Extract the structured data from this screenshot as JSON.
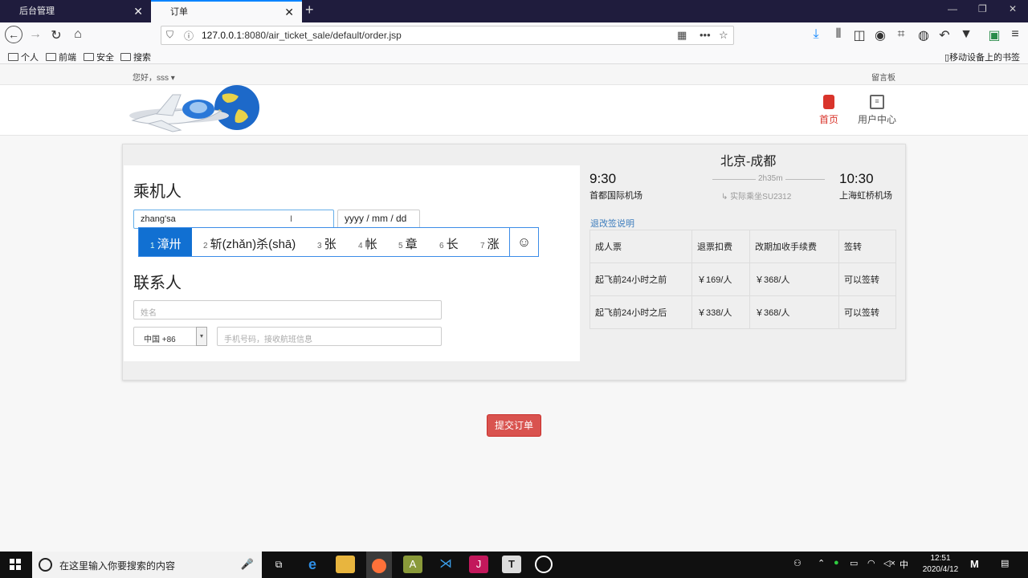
{
  "browser": {
    "tabs": [
      {
        "title": "后台管理"
      },
      {
        "title": "订单"
      }
    ],
    "url_host": "127.0.0.1",
    "url_rest": ":8080/air_ticket_sale/default/order.jsp",
    "bookmarks": [
      "个人",
      "前端",
      "安全",
      "搜索"
    ],
    "mobile_bookmarks": "移动设备上的书签"
  },
  "site": {
    "greeting": "您好，sss",
    "message_board": "留言板",
    "nav": [
      {
        "label": "首页"
      },
      {
        "label": "用户中心"
      }
    ]
  },
  "passenger": {
    "heading": "乘机人",
    "name_value": "zhang'sa",
    "date_placeholder": "yyyy / mm / dd"
  },
  "ime": {
    "candidates": [
      {
        "n": "1",
        "text": "漳卅"
      },
      {
        "n": "2",
        "text": "斩(zhǎn)杀(shā)"
      },
      {
        "n": "3",
        "text": "张"
      },
      {
        "n": "4",
        "text": "帐"
      },
      {
        "n": "5",
        "text": "章"
      },
      {
        "n": "6",
        "text": "长"
      },
      {
        "n": "7",
        "text": "涨"
      }
    ],
    "emoji": "☺"
  },
  "contact": {
    "heading": "联系人",
    "name_placeholder": "姓名",
    "country": "中国  +86",
    "phone_placeholder": "手机号码，接收航班信息"
  },
  "flight": {
    "route": "北京-成都",
    "depart_time": "9:30",
    "depart_airport": "首都国际机场",
    "arrive_time": "10:30",
    "arrive_airport": "上海虹桥机场",
    "duration": "2h35m",
    "flight_no": "实际乘坐SU2312",
    "refund_link": "退改签说明",
    "table": {
      "headers": [
        "成人票",
        "退票扣费",
        "改期加收手续费",
        "签转"
      ],
      "rows": [
        [
          "起飞前24小时之前",
          "￥169/人",
          "￥368/人",
          "可以签转"
        ],
        [
          "起飞前24小时之后",
          "￥338/人",
          "￥368/人",
          "可以签转"
        ]
      ]
    }
  },
  "submit_label": "提交订单",
  "taskbar": {
    "search_placeholder": "在这里输入你要搜索的内容",
    "time": "12:51",
    "date": "2020/4/12",
    "ime_indicator": "中"
  }
}
